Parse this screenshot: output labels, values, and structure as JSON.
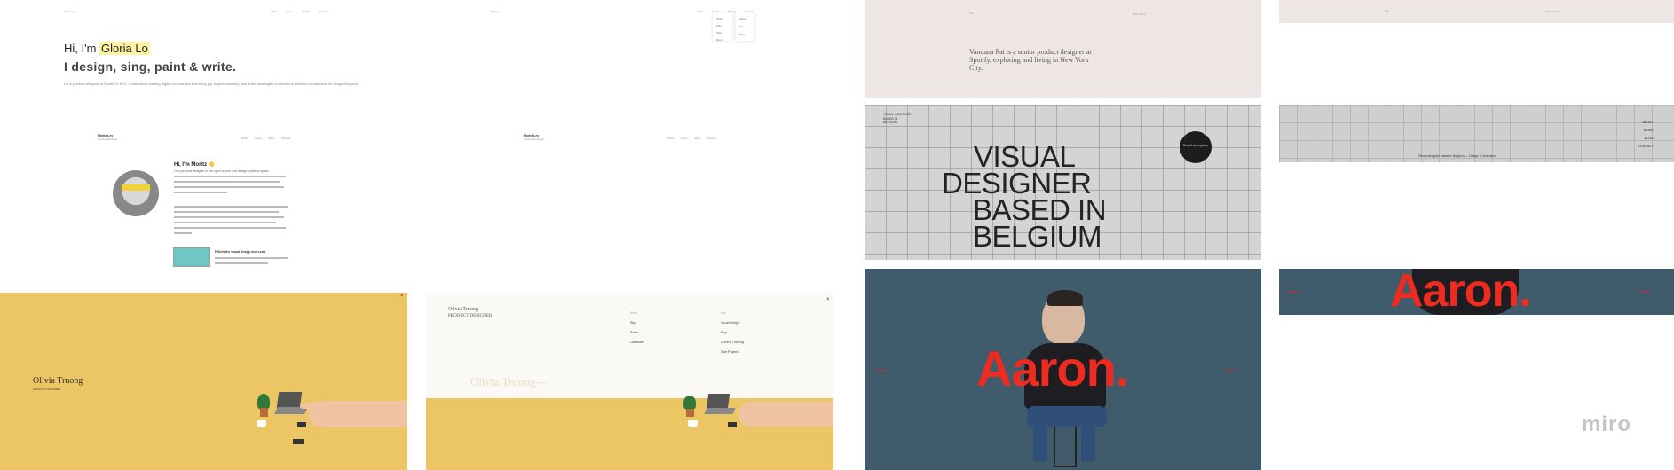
{
  "gloria": {
    "logo": "Gloria Lo",
    "nav": [
      "Work",
      "About",
      "Writing",
      "Contact"
    ],
    "greeting": "Hi, I'm ",
    "name": "Gloria Lo",
    "tagline": "I design, sing, paint & write.",
    "paragraph": "I'm a product designer at Spotify in NYC. I care about crafting digital experiences that bring joy, inspire creativity, and build meaningful connections between people and the things they love."
  },
  "gloria_dropdown": {
    "col1": [
      "Work",
      "Play",
      "Side",
      "More"
    ],
    "col2": [
      "About",
      "CV",
      "Blog"
    ]
  },
  "moritz": {
    "site_name": "Moritz Ley",
    "site_role": "Product Designer",
    "nav": [
      "Work",
      "About",
      "Blog",
      "Contact"
    ],
    "greeting": "Hi, I'm Moritz 👋",
    "bio": "I'm a product designer in the open source and design systems space.",
    "card_title": "Follow the visual design and code"
  },
  "olivia": {
    "name": "Olivia Truong",
    "role": "PRODUCT DESIGNER",
    "name_dash": "Olivia Truong—",
    "subtitle": "PRODUCT DESIGNER",
    "close_icon_label": "×",
    "menu_col1_header": "Work",
    "menu_col1": [
      "Sky",
      "Pulse",
      "Lab Notes"
    ],
    "menu_col2_header": "Info",
    "menu_col2": [
      "Visual Design",
      "Play",
      "Current Thinking",
      "Side Projects"
    ],
    "ghost": "Olivia Truong—"
  },
  "vandana": {
    "logo": "V.P.",
    "nav": "Work   About",
    "text": "Vandana Pai is a senior product designer at Spotify, exploring and living in New York City."
  },
  "visual": {
    "corner": [
      "VISUAL DESIGNER",
      "BASED IN",
      "BELGIUM"
    ],
    "lines": [
      "VISUAL",
      "DESIGNER",
      "BASED IN",
      "BELGIUM"
    ],
    "badge": "Scroll to explore",
    "side_nav": [
      "ABOUT",
      "WORK",
      "BLOG",
      "CONTACT"
    ],
    "footer": "Visual designer based in Belgium — Design & illustration"
  },
  "aaron": {
    "big": "Aaron.",
    "left_tag": "Designer",
    "right_tag": "Portfolio",
    "small": "Aaron."
  },
  "watermark": "miro"
}
